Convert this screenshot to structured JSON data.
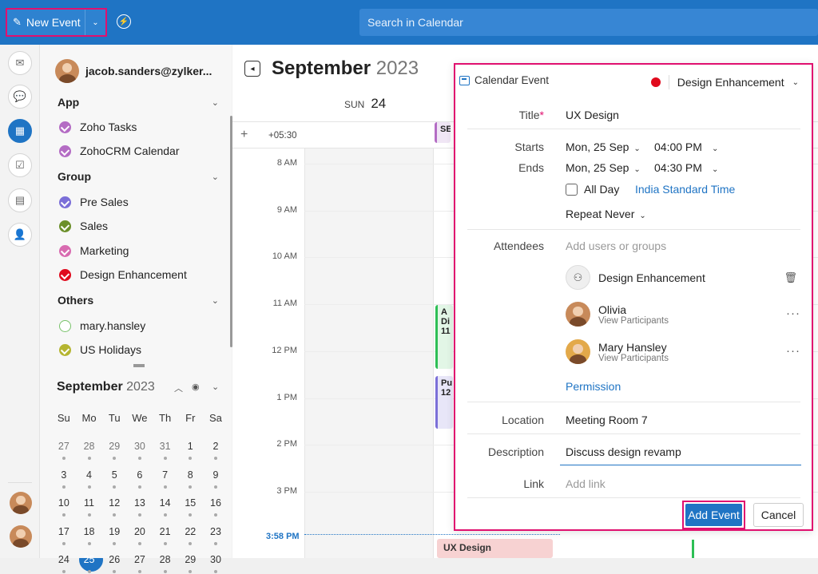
{
  "topbar": {
    "new_event": "New Event",
    "search_placeholder": "Search in Calendar"
  },
  "sidebar": {
    "user_email": "jacob.sanders@zylker...",
    "sections": [
      {
        "title": "App",
        "items": [
          {
            "label": "Zoho Tasks",
            "color": "#b46cc4"
          },
          {
            "label": "ZohoCRM Calendar",
            "color": "#b46cc4"
          }
        ]
      },
      {
        "title": "Group",
        "items": [
          {
            "label": "Pre Sales",
            "color": "#7b6fd8"
          },
          {
            "label": "Sales",
            "color": "#6b8f2a"
          },
          {
            "label": "Marketing",
            "color": "#d86bb0"
          },
          {
            "label": "Design Enhancement",
            "color": "#e00a1d"
          }
        ]
      },
      {
        "title": "Others",
        "items": [
          {
            "label": "mary.hansley",
            "color": "#78c26a",
            "checked": false
          },
          {
            "label": "US Holidays",
            "color": "#b5b530"
          }
        ]
      }
    ],
    "mini_calendar": {
      "month": "September",
      "year": "2023",
      "weekdays": [
        "Su",
        "Mo",
        "Tu",
        "We",
        "Th",
        "Fr",
        "Sa"
      ],
      "weeks": [
        [
          "27",
          "28",
          "29",
          "30",
          "31",
          "1",
          "2"
        ],
        [
          "3",
          "4",
          "5",
          "6",
          "7",
          "8",
          "9"
        ],
        [
          "10",
          "11",
          "12",
          "13",
          "14",
          "15",
          "16"
        ],
        [
          "17",
          "18",
          "19",
          "20",
          "21",
          "22",
          "23"
        ],
        [
          "24",
          "25",
          "26",
          "27",
          "28",
          "29",
          "30"
        ]
      ],
      "today": "25"
    }
  },
  "calendar": {
    "month": "September",
    "year": "2023",
    "day_name": "SUN",
    "day_num": "24",
    "timezone_offset": "+05:30",
    "hours": [
      "8 AM",
      "9 AM",
      "10 AM",
      "11 AM",
      "12 PM",
      "1 PM",
      "2 PM",
      "3 PM"
    ],
    "now_label": "3:58 PM",
    "events": [
      {
        "label": "SE"
      },
      {
        "label": "A",
        "line2": "Di",
        "line3": "11"
      },
      {
        "label": "Pu",
        "line2": "12"
      },
      {
        "label": "UX Design"
      }
    ]
  },
  "event_form": {
    "header": "Calendar Event",
    "calendar_name": "Design Enhancement",
    "title_label": "Title",
    "title_required": "*",
    "title_value": "UX Design",
    "starts_label": "Starts",
    "starts_date": "Mon, 25 Sep",
    "starts_time": "04:00 PM",
    "ends_label": "Ends",
    "ends_date": "Mon, 25 Sep",
    "ends_time": "04:30 PM",
    "all_day": "All Day",
    "timezone": "India Standard Time",
    "repeat": "Repeat Never",
    "attendees_label": "Attendees",
    "attendees_placeholder": "Add users or groups",
    "attendees": [
      {
        "name": "Design Enhancement"
      },
      {
        "name": "Olivia",
        "sub": "View Participants"
      },
      {
        "name": "Mary Hansley",
        "sub": "View Participants"
      }
    ],
    "permission": "Permission",
    "location_label": "Location",
    "location_value": "Meeting Room 7",
    "description_label": "Description",
    "description_value": "Discuss design revamp",
    "link_label": "Link",
    "link_placeholder": "Add link",
    "add_button": "Add Event",
    "cancel_button": "Cancel"
  }
}
